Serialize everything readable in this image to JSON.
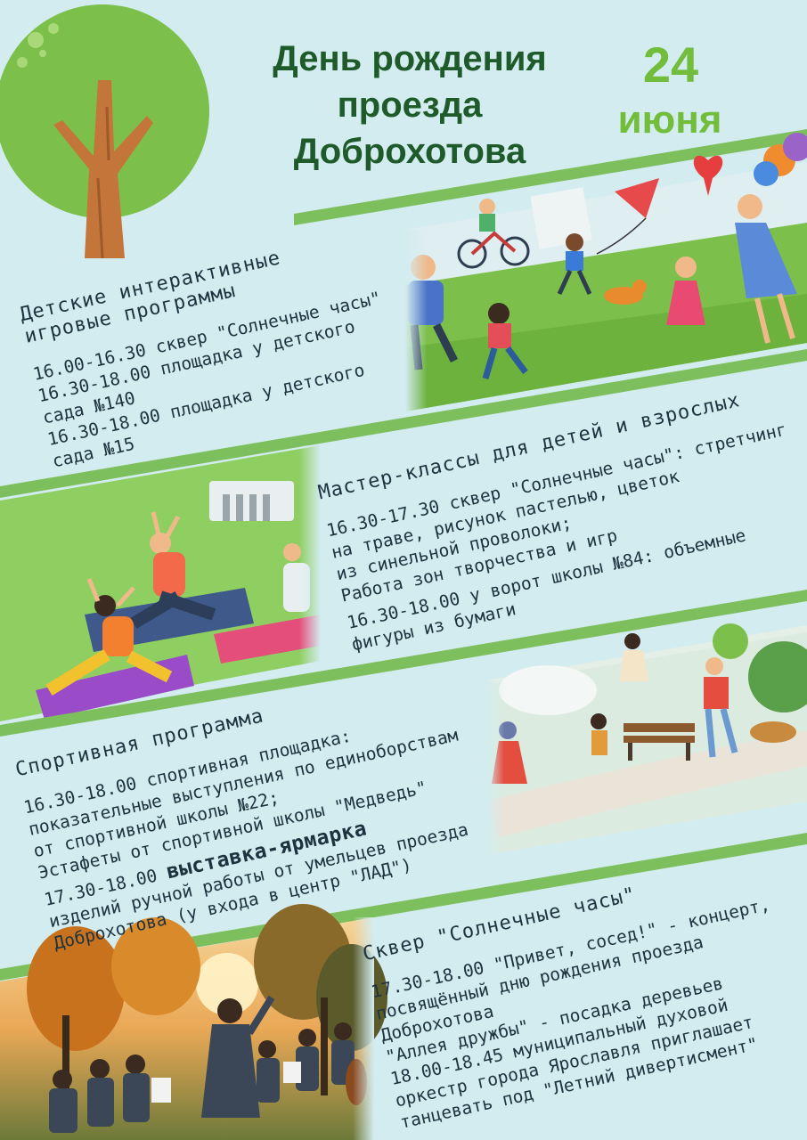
{
  "header": {
    "title_lines": [
      "День рождения",
      "проезда",
      "Доброхотова"
    ],
    "date_day": "24",
    "date_month": "июня"
  },
  "sections": [
    {
      "heading_lines": [
        "Детские интерактивные",
        "игровые программы"
      ],
      "lines": [
        "16.00-16.30 сквер \"Солнечные часы\"",
        "16.30-18.00 площадка у детского",
        "сада №140",
        "16.30-18.00 площадка у детского",
        "сада №15"
      ]
    },
    {
      "heading": "Мастер-классы для детей и взрослых",
      "lines": [
        "16.30-17.30 сквер \"Солнечные часы\": стретчинг",
        "на траве, рисунок пастелью, цветок",
        "из синельной проволоки;",
        "Работа зон творчества и игр",
        "16.30-18.00 у ворот школы №84: объемные",
        "фигуры из бумаги"
      ]
    },
    {
      "heading": "Спортивная программа",
      "lines": [
        "16.30-18.00 спортивная площадка:",
        "показательные выступления по единоборствам",
        "от спортивной школы №22;",
        "Эстафеты от спортивной школы \"Медведь\""
      ],
      "fair_time": "17.30-18.00",
      "fair_title": "выставка-ярмарка",
      "fair_lines": [
        "изделий ручной работы от умельцев проезда",
        "Доброхотова (у входа в центр \"ЛАД\")"
      ]
    },
    {
      "heading": "Сквер \"Солнечные часы\"",
      "lines": [
        "17.30-18.00 \"Привет, сосед!\" - концерт,",
        "посвящённый дню рождения проезда",
        "Доброхотова",
        "\"Аллея дружбы\" - посадка деревьев",
        "18.00-18.45 муниципальный духовой",
        "оркестр города Ярославля приглашает",
        "танцевать под \"Летний дивертисмент\""
      ]
    }
  ],
  "colors": {
    "background": "#d3ecef",
    "stripe": "#7dbf5c",
    "title": "#1e5a2a",
    "accent": "#72bd3b",
    "text": "#1e3340"
  },
  "illustrations": [
    "tree-illustration",
    "park-kids-illustration",
    "yoga-illustration",
    "park-walk-illustration",
    "orchestra-illustration"
  ]
}
